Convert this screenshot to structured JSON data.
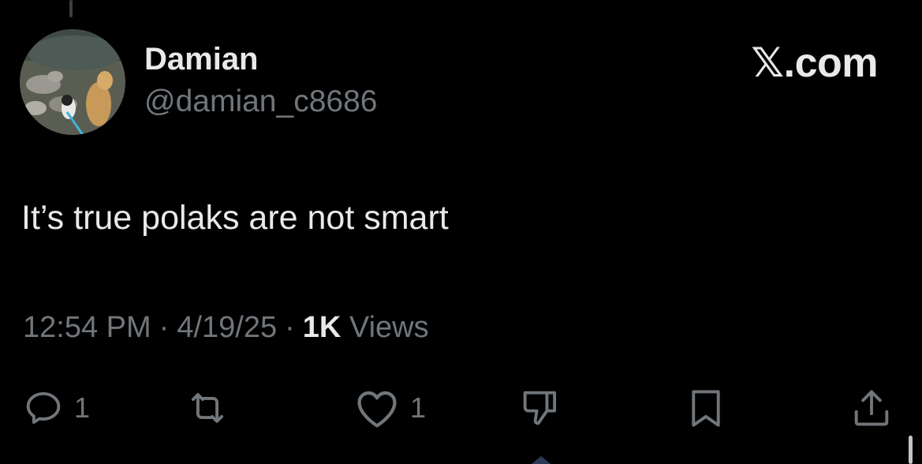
{
  "site": {
    "logo_text": "𝕏.com"
  },
  "author": {
    "display_name": "Damian",
    "handle": "@damian_c8686"
  },
  "tweet": {
    "text": "It’s true polaks are not smart",
    "time": "12:54 PM",
    "date": "4/19/25",
    "views_count": "1K",
    "views_label": "Views",
    "separator": "·"
  },
  "actions": {
    "reply": {
      "icon": "reply-icon",
      "count": "1"
    },
    "repost": {
      "icon": "repost-icon",
      "count": ""
    },
    "like": {
      "icon": "heart-icon",
      "count": "1"
    },
    "downvote": {
      "icon": "thumbs-down-icon",
      "count": ""
    },
    "bookmark": {
      "icon": "bookmark-icon",
      "count": ""
    },
    "share": {
      "icon": "share-icon",
      "count": ""
    }
  },
  "colors": {
    "background": "#000000",
    "primary_text": "#e7e9ea",
    "secondary_text": "#71767b"
  }
}
